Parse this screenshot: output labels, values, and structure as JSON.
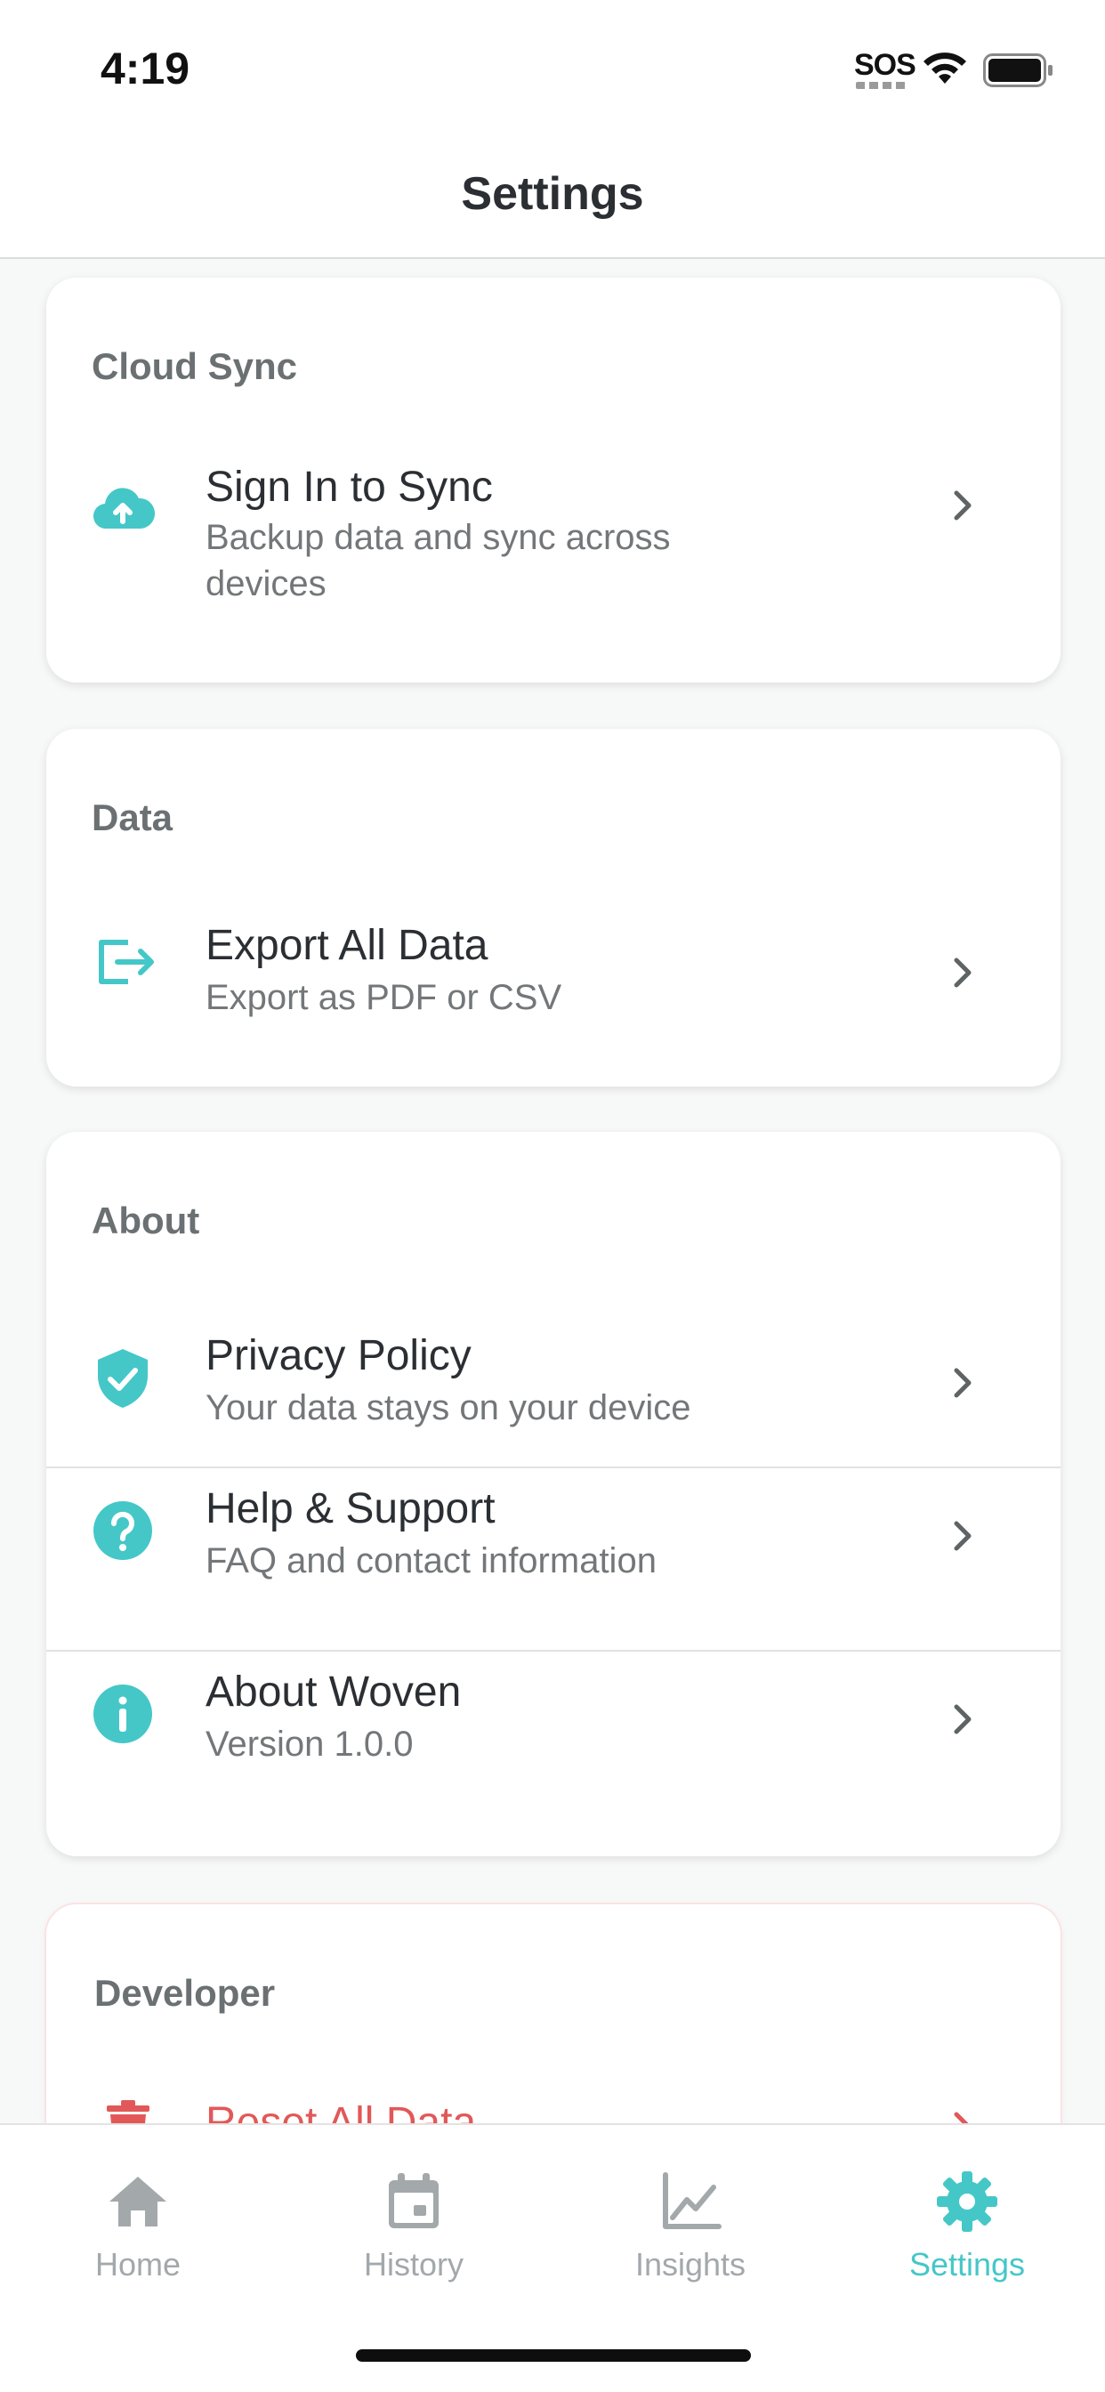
{
  "status_bar": {
    "time": "4:19",
    "sos": "SOS"
  },
  "nav": {
    "title": "Settings"
  },
  "sections": {
    "cloud_sync": {
      "title": "Cloud Sync",
      "items": [
        {
          "title": "Sign In to Sync",
          "subtitle": "Backup data and sync across devices",
          "icon": "cloud-upload-icon"
        }
      ]
    },
    "data": {
      "title": "Data",
      "items": [
        {
          "title": "Export All Data",
          "subtitle": "Export as PDF or CSV",
          "icon": "export-icon"
        }
      ]
    },
    "about": {
      "title": "About",
      "items": [
        {
          "title": "Privacy Policy",
          "subtitle": "Your data stays on your device",
          "icon": "shield-check-icon"
        },
        {
          "title": "Help & Support",
          "subtitle": "FAQ and contact information",
          "icon": "help-icon"
        },
        {
          "title": "About Woven",
          "subtitle": "Version 1.0.0",
          "icon": "info-icon"
        }
      ]
    },
    "developer": {
      "title": "Developer",
      "items": [
        {
          "title": "Reset All Data",
          "icon": "trash-icon"
        }
      ]
    }
  },
  "tabs": [
    {
      "label": "Home",
      "icon": "home-icon",
      "active": false
    },
    {
      "label": "History",
      "icon": "calendar-icon",
      "active": false
    },
    {
      "label": "Insights",
      "icon": "chart-icon",
      "active": false
    },
    {
      "label": "Settings",
      "icon": "gear-icon",
      "active": true
    }
  ],
  "colors": {
    "accent": "#45c7c8",
    "danger": "#e25858",
    "inactive": "#a3a8ab",
    "text": "#2b2f33"
  }
}
